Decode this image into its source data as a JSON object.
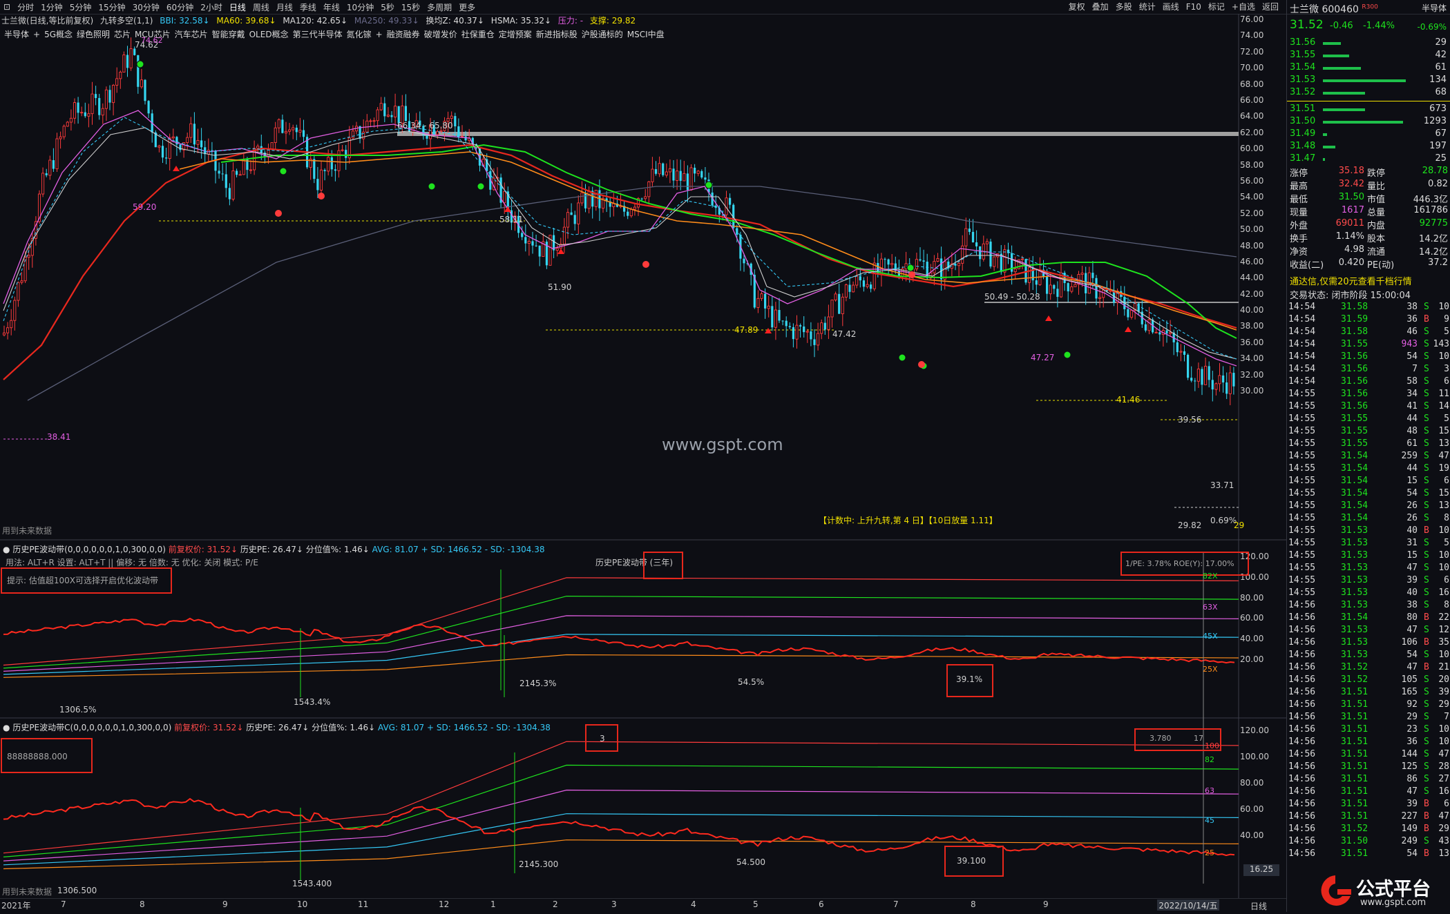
{
  "toolbar": {
    "periods": [
      "分时",
      "1分钟",
      "5分钟",
      "15分钟",
      "30分钟",
      "60分钟",
      "2小时",
      "日线",
      "周线",
      "月线",
      "季线",
      "年线",
      "10分钟",
      "5秒",
      "15秒",
      "多周期",
      "更多"
    ],
    "selected": "日线",
    "tools": [
      "复权",
      "叠加",
      "多股",
      "统计",
      "画线",
      "F10",
      "标记",
      "+自选",
      "返回"
    ]
  },
  "info": {
    "title": "士兰微(日线,等比前复权)",
    "nine_turn": "九转多空(1,1)",
    "bbi": "BBI: 32.58↓",
    "ma60": "MA60: 39.68↓",
    "ma120": "MA120: 42.65↓",
    "ma250": "MA250: 49.33↓",
    "hsl": "换均Z: 40.37↓",
    "hsma": "HSMA: 35.32↓",
    "pressure": "压力: -",
    "support": "支撑: 29.82"
  },
  "concepts": [
    "半导体",
    "+",
    "5G概念",
    "绿色照明",
    "芯片",
    "MCU芯片",
    "汽车芯片",
    "智能穿戴",
    "OLED概念",
    "第三代半导体",
    "氮化镓",
    "+",
    "融资融券",
    "破增发价",
    "社保重仓",
    "定增预案",
    "新进指标股",
    "沪股通标的",
    "MSCI中盘"
  ],
  "annotations": {
    "high": "74.62",
    "high2": "74.62",
    "range_top": "66.34 - 65.80",
    "l59": "59.20",
    "l58": "58.11",
    "l51": "51.90",
    "l47a": "47.89",
    "l47b": "47.42",
    "l4727": "47.27",
    "range2": "50.49 - 50.28",
    "l4146": "41.46",
    "l3956": "39.56",
    "l3841": "38.41",
    "l3371": "33.71",
    "low": "29.82",
    "pct": "0.69%",
    "l29": "29",
    "watermark": "www.gspt.com",
    "counter": "【计数中:  上升九转,第 4 日】【10日放量 1.11】",
    "future_data": "用到未来数据"
  },
  "price_axis": [
    "76.00",
    "74.00",
    "72.00",
    "70.00",
    "68.00",
    "66.00",
    "64.00",
    "62.00",
    "60.00",
    "58.00",
    "56.00",
    "54.00",
    "52.00",
    "50.00",
    "48.00",
    "46.00",
    "44.00",
    "42.00",
    "40.00",
    "38.00",
    "36.00",
    "34.00",
    "32.00",
    "30.00"
  ],
  "panel1": {
    "header": [
      "历史PE波动带(0,0,0,0,0,0,1,0,300,0,0)",
      "前复权价: 31.52↓",
      "历史PE: 26.47↓",
      "分位值%: 1.46↓",
      "AVG: 81.07",
      "+ SD: 1466.52",
      "- SD: -1304.38"
    ],
    "usage": "用法: ALT+R  设置: ALT+T  ||  偏移: 无  倍数: 无  优化: 关闭  模式: P/E",
    "tip": "提示: 估值超100X可选择开启优化波动带",
    "center_title": "历史PE波动带 (三年)",
    "right_info": "1/PE: 3.78%  ROE(Y): 17.00%",
    "band_labels": [
      "82X",
      "63X",
      "45X",
      "25X"
    ],
    "values": [
      "1306.5%",
      "1543.4%",
      "2145.3%",
      "54.5%",
      "39.1%"
    ],
    "axis": [
      "120.00",
      "100.00",
      "80.00",
      "60.00",
      "40.00",
      "20.00"
    ]
  },
  "panel2": {
    "header": [
      "历史PE波动带C(0,0,0,0,0,0,1,0,300,0,0)",
      "前复权价: 31.52↓",
      "历史PE: 26.47↓",
      "分位值%: 1.46↓",
      "AVG: 81.07",
      "+ SD: 1466.52",
      "- SD: -1304.38"
    ],
    "left_value": "88888888.000",
    "center_value": "3",
    "right_info_a": "3.780",
    "right_info_b": "17",
    "band_labels": [
      "100",
      "82",
      "63",
      "45",
      "25"
    ],
    "values": [
      "1306.500",
      "1543.400",
      "2145.300",
      "54.500",
      "39.100"
    ],
    "axis": [
      "120.00",
      "100.00",
      "80.00",
      "60.00",
      "40.00"
    ],
    "axis_box": "16.25",
    "future_data": "用到未来数据"
  },
  "xaxis": {
    "labels": [
      "2021年",
      "7",
      "8",
      "9",
      "10",
      "11",
      "12",
      "1",
      "2",
      "3",
      "4",
      "5",
      "6",
      "7",
      "8",
      "9"
    ],
    "date_box": "2022/10/14/五",
    "period": "日线"
  },
  "sidebar": {
    "sector": "半导体",
    "name": "士兰微 600460",
    "badge": "R300",
    "price": "31.52",
    "change": "-0.46",
    "change_pct": "-1.44%",
    "corner_pct": "-0.69%",
    "asks": [
      {
        "p": "31.56",
        "v": "29"
      },
      {
        "p": "31.55",
        "v": "42"
      },
      {
        "p": "31.54",
        "v": "61"
      },
      {
        "p": "31.53",
        "v": "134"
      },
      {
        "p": "31.52",
        "v": "68"
      }
    ],
    "bids": [
      {
        "p": "31.51",
        "v": "673"
      },
      {
        "p": "31.50",
        "v": "1293"
      },
      {
        "p": "31.49",
        "v": "67"
      },
      {
        "p": "31.48",
        "v": "197"
      },
      {
        "p": "31.47",
        "v": "25"
      }
    ],
    "stats": [
      {
        "l1": "涨停",
        "v1": "35.18",
        "l2": "跌停",
        "v2": "28.78"
      },
      {
        "l1": "最高",
        "v1": "32.42",
        "l2": "量比",
        "v2": "0.82"
      },
      {
        "l1": "最低",
        "v1": "31.50",
        "l2": "市值",
        "v2": "446.3亿"
      },
      {
        "l1": "现量",
        "v1": "1617",
        "l2": "总量",
        "v2": "161786"
      },
      {
        "l1": "外盘",
        "v1": "69011",
        "l2": "内盘",
        "v2": "92775"
      },
      {
        "l1": "换手",
        "v1": "1.14%",
        "l2": "股本",
        "v2": "14.2亿"
      },
      {
        "l1": "净资",
        "v1": "4.98",
        "l2": "流通",
        "v2": "14.2亿"
      },
      {
        "l1": "收益(二)",
        "v1": "0.420",
        "l2": "PE(动)",
        "v2": "37.2"
      }
    ],
    "notice": "通达信,仅需20元查看千档行情",
    "status": "交易状态: 闭市阶段 15:00:04",
    "ticks": [
      [
        "14:54",
        "31.58",
        "38",
        "S",
        "10"
      ],
      [
        "14:54",
        "31.59",
        "36",
        "B",
        "9"
      ],
      [
        "14:54",
        "31.58",
        "46",
        "S",
        "5"
      ],
      [
        "14:54",
        "31.55",
        "943",
        "S",
        "143"
      ],
      [
        "14:54",
        "31.56",
        "54",
        "S",
        "10"
      ],
      [
        "14:54",
        "31.56",
        "7",
        "S",
        "3"
      ],
      [
        "14:54",
        "31.56",
        "58",
        "S",
        "6"
      ],
      [
        "14:55",
        "31.56",
        "34",
        "S",
        "11"
      ],
      [
        "14:55",
        "31.56",
        "41",
        "S",
        "14"
      ],
      [
        "14:55",
        "31.55",
        "44",
        "S",
        "5"
      ],
      [
        "14:55",
        "31.55",
        "48",
        "S",
        "15"
      ],
      [
        "14:55",
        "31.55",
        "61",
        "S",
        "13"
      ],
      [
        "14:55",
        "31.54",
        "259",
        "S",
        "47"
      ],
      [
        "14:55",
        "31.54",
        "44",
        "S",
        "19"
      ],
      [
        "14:55",
        "31.54",
        "15",
        "S",
        "6"
      ],
      [
        "14:55",
        "31.54",
        "54",
        "S",
        "15"
      ],
      [
        "14:55",
        "31.54",
        "26",
        "S",
        "13"
      ],
      [
        "14:55",
        "31.54",
        "26",
        "S",
        "8"
      ],
      [
        "14:55",
        "31.53",
        "40",
        "B",
        "10"
      ],
      [
        "14:55",
        "31.53",
        "31",
        "S",
        "5"
      ],
      [
        "14:55",
        "31.53",
        "15",
        "S",
        "10"
      ],
      [
        "14:55",
        "31.53",
        "47",
        "S",
        "10"
      ],
      [
        "14:55",
        "31.53",
        "39",
        "S",
        "6"
      ],
      [
        "14:55",
        "31.53",
        "40",
        "S",
        "16"
      ],
      [
        "14:56",
        "31.53",
        "38",
        "S",
        "8"
      ],
      [
        "14:56",
        "31.54",
        "80",
        "B",
        "22"
      ],
      [
        "14:56",
        "31.53",
        "47",
        "S",
        "12"
      ],
      [
        "14:56",
        "31.53",
        "106",
        "B",
        "35"
      ],
      [
        "14:56",
        "31.53",
        "54",
        "S",
        "10"
      ],
      [
        "14:56",
        "31.52",
        "47",
        "B",
        "21"
      ],
      [
        "14:56",
        "31.52",
        "105",
        "S",
        "20"
      ],
      [
        "14:56",
        "31.51",
        "165",
        "S",
        "39"
      ],
      [
        "14:56",
        "31.51",
        "92",
        "S",
        "29"
      ],
      [
        "14:56",
        "31.51",
        "29",
        "S",
        "7"
      ],
      [
        "14:56",
        "31.51",
        "23",
        "S",
        "10"
      ],
      [
        "14:56",
        "31.51",
        "36",
        "S",
        "10"
      ],
      [
        "14:56",
        "31.51",
        "144",
        "S",
        "47"
      ],
      [
        "14:56",
        "31.51",
        "125",
        "S",
        "28"
      ],
      [
        "14:56",
        "31.51",
        "86",
        "S",
        "27"
      ],
      [
        "14:56",
        "31.51",
        "47",
        "S",
        "16"
      ],
      [
        "14:56",
        "31.51",
        "39",
        "B",
        "6"
      ],
      [
        "14:56",
        "31.51",
        "227",
        "B",
        "47"
      ],
      [
        "14:56",
        "31.52",
        "149",
        "B",
        "29"
      ],
      [
        "14:56",
        "31.50",
        "249",
        "S",
        "43"
      ],
      [
        "14:56",
        "31.51",
        "54",
        "B",
        "13"
      ]
    ],
    "logo_text": "公式平台",
    "logo_url": "www.gspt.com"
  },
  "colors": {
    "red": "#ff3b3b",
    "green": "#1ee31e",
    "cyan": "#35c9f7",
    "orange": "#ff8c1a",
    "magenta": "#e35fe3",
    "white": "#d0d0d0",
    "box": "#e8271c"
  }
}
